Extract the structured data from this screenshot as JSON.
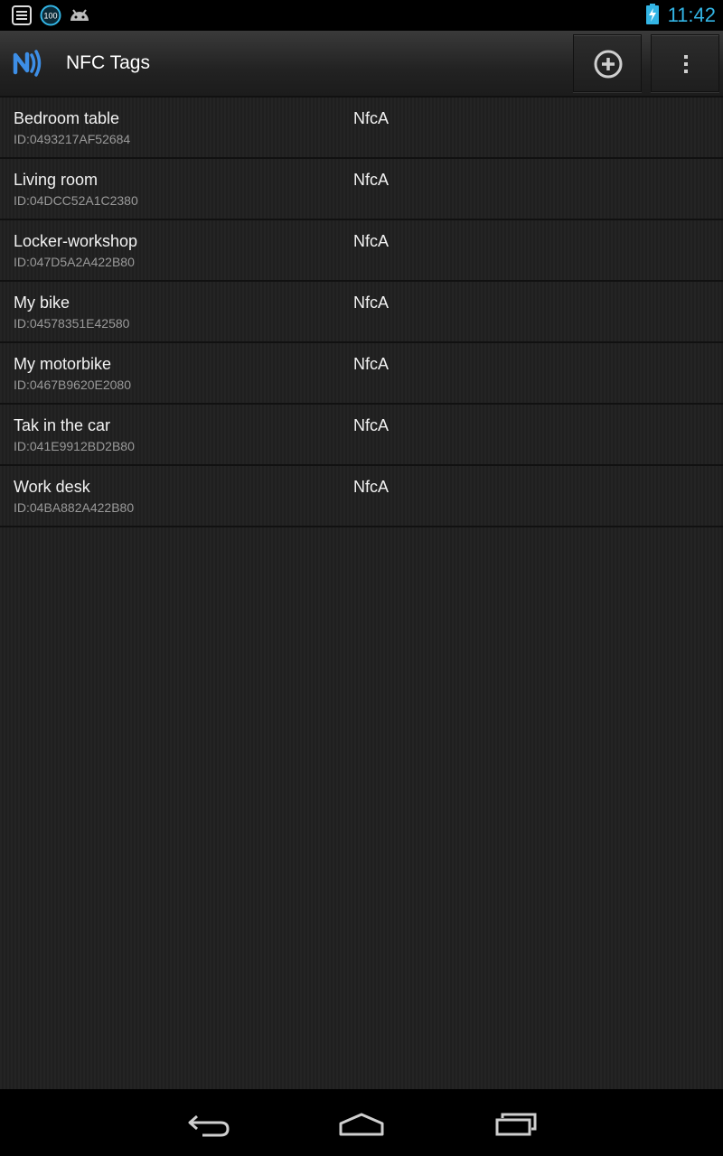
{
  "status_bar": {
    "time": "11:42",
    "icons": [
      "notes-icon",
      "battery-100-notification-icon",
      "android-icon",
      "battery-charging-icon"
    ],
    "notification_badge": "100",
    "accent_color": "#33b5e5"
  },
  "action_bar": {
    "title": "NFC Tags",
    "app_icon": "nfc-icon",
    "actions": [
      {
        "icon": "add-circle-icon"
      },
      {
        "icon": "overflow-menu-icon"
      }
    ]
  },
  "tags": [
    {
      "name": "Bedroom table",
      "id": "ID:0493217AF52684",
      "tech": "NfcA"
    },
    {
      "name": "Living room",
      "id": "ID:04DCC52A1C2380",
      "tech": "NfcA"
    },
    {
      "name": "Locker-workshop",
      "id": "ID:047D5A2A422B80",
      "tech": "NfcA"
    },
    {
      "name": "My bike",
      "id": "ID:04578351E42580",
      "tech": "NfcA"
    },
    {
      "name": "My motorbike",
      "id": "ID:0467B9620E2080",
      "tech": "NfcA"
    },
    {
      "name": "Tak in the car",
      "id": "ID:041E9912BD2B80",
      "tech": "NfcA"
    },
    {
      "name": "Work desk",
      "id": "ID:04BA882A422B80",
      "tech": "NfcA"
    }
  ],
  "nav_bar": {
    "buttons": [
      "back-icon",
      "home-icon",
      "recents-icon"
    ]
  }
}
